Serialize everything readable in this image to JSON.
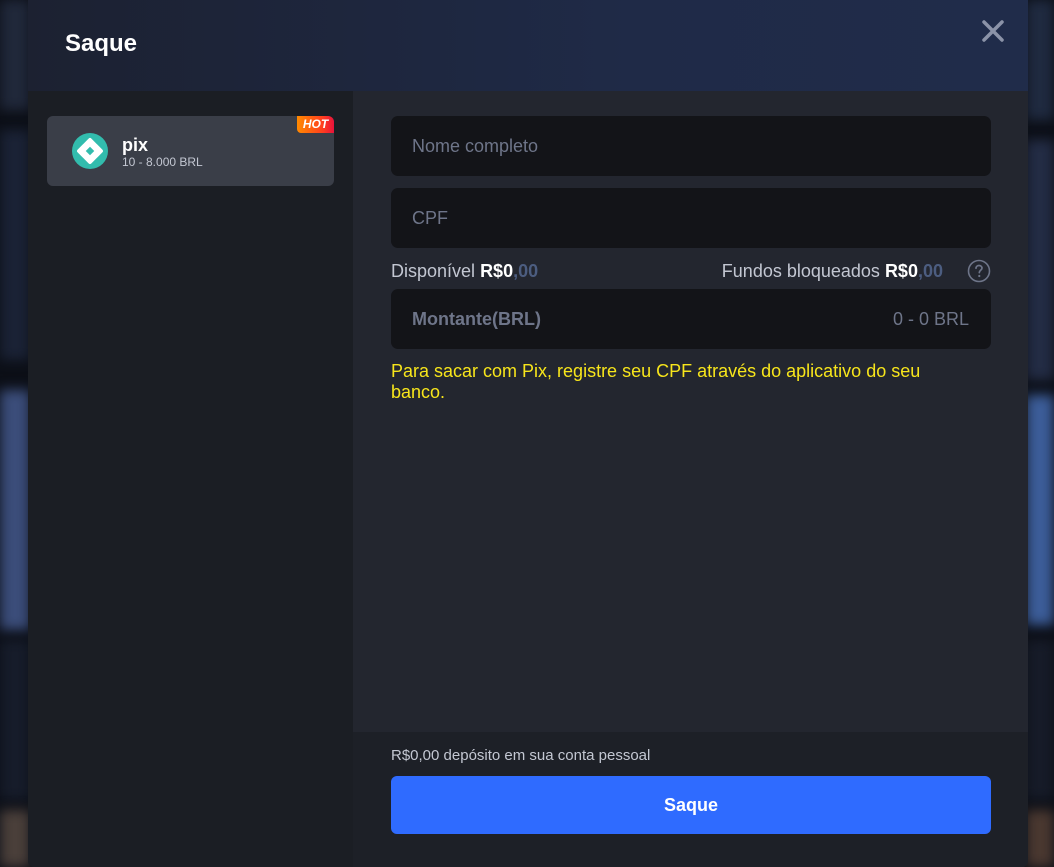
{
  "modal": {
    "title": "Saque",
    "close_icon": "close-icon"
  },
  "sidebar": {
    "methods": [
      {
        "name": "pix",
        "range": "10 - 8.000 BRL",
        "badge": "HOT",
        "icon": "pix-logo-icon",
        "selected": true
      }
    ]
  },
  "form": {
    "full_name": {
      "placeholder": "Nome completo",
      "value": ""
    },
    "cpf": {
      "placeholder": "CPF",
      "value": ""
    },
    "available": {
      "label": "Disponível",
      "currency": "R$",
      "whole": "0",
      "decimals": ",00"
    },
    "blocked": {
      "label": "Fundos bloqueados",
      "currency": "R$",
      "whole": "0",
      "decimals": ",00",
      "help_icon": "question-circle-icon"
    },
    "amount": {
      "label": "Montante(BRL)",
      "range": "0 - 0 BRL"
    },
    "notice": "Para sacar com Pix, registre seu CPF através do aplicativo do seu banco."
  },
  "footer": {
    "deposit_text": "R$0,00 depósito em sua conta pessoal",
    "submit_label": "Saque"
  },
  "colors": {
    "accent": "#2f6bff",
    "notice": "#f7e51b",
    "hot_badge": "#ff5a1f"
  }
}
